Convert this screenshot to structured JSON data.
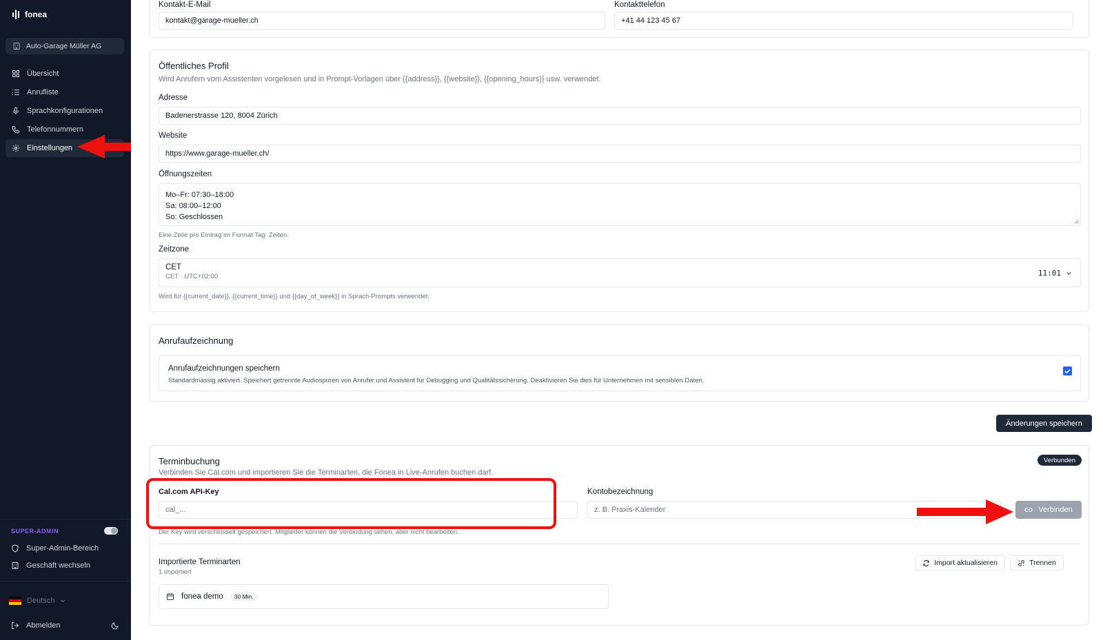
{
  "app": {
    "name": "fonea"
  },
  "sidebar": {
    "company": "Auto-Garage Müller AG",
    "items": [
      {
        "label": "Übersicht",
        "icon": "grid-icon"
      },
      {
        "label": "Anrufliste",
        "icon": "list-icon"
      },
      {
        "label": "Sprachkonfigurationen",
        "icon": "mic-icon"
      },
      {
        "label": "Telefonnummern",
        "icon": "phone-icon"
      },
      {
        "label": "Einstellungen",
        "icon": "gear-icon",
        "active": true
      }
    ],
    "super_admin_label": "SUPER-ADMIN",
    "super_admin_items": [
      {
        "label": "Super-Admin-Bereich",
        "icon": "shield-icon"
      },
      {
        "label": "Geschäft wechseln",
        "icon": "building-icon"
      }
    ],
    "language": "Deutsch",
    "logout": "Abmelden"
  },
  "contact": {
    "email_label": "Kontakt-E-Mail",
    "email_value": "kontakt@garage-mueller.ch",
    "phone_label": "Kontakttelefon",
    "phone_value": "+41 44 123 45 67"
  },
  "profile": {
    "title": "Öffentliches Profil",
    "description": "Wird Anrufern vom Assistenten vorgelesen und in Prompt-Vorlagen über {{address}}, {{website}}, {{opening_hours}} usw. verwendet.",
    "address_label": "Adresse",
    "address_value": "Badenerstrasse 120, 8004 Zürich",
    "website_label": "Website",
    "website_value": "https://www.garage-mueller.ch/",
    "hours_label": "Öffnungszeiten",
    "hours_lines": [
      "Mo–Fr: 07:30–18:00",
      "Sa: 08:00–12:00",
      "So: Geschlossen"
    ],
    "hours_hint": "Eine Zeile pro Eintrag im Format Tag: Zeiten.",
    "timezone_label": "Zeitzone",
    "timezone_value": "CET",
    "timezone_sub": "CET · UTC+02:00",
    "timezone_time": "11:01",
    "timezone_hint": "Wird für {{current_date}}, {{current_time}} und {{day_of_week}} in Sprach-Prompts verwendet."
  },
  "recording": {
    "title": "Anrufaufzeichnung",
    "option_title": "Anrufaufzeichnungen speichern",
    "option_description": "Standardmässig aktiviert. Speichert getrennte Audiospuren von Anrufer und Assistent für Debugging und Qualitätssicherung. Deaktivieren Sie dies für Unternehmen mit sensiblen Daten.",
    "checked": true
  },
  "save_button": "Änderungen speichern",
  "booking": {
    "title": "Terminbuchung",
    "description": "Verbinden Sie Cal.com und importieren Sie die Terminarten, die Fonea in Live-Anrufen buchen darf.",
    "status_badge": "Verbunden",
    "api_key_label": "Cal.com API-Key",
    "api_key_placeholder": "cal_...",
    "account_label": "Kontobezeichnung",
    "account_placeholder": "z. B. Praxis-Kalender",
    "connect_button": "Verbinden",
    "key_hint": "Der Key wird verschlüsselt gespeichert. Mitglieder können die Verbindung sehen, aber nicht bearbeiten.",
    "imported_title": "Importierte Terminarten",
    "imported_count": "1 importiert",
    "refresh_button": "Import aktualisieren",
    "disconnect_button": "Trennen",
    "event_types": [
      {
        "name": "fonea demo",
        "duration": "30 Min."
      }
    ]
  },
  "colors": {
    "sidebar": "#111827",
    "accent": "#1f2937",
    "annotation": "#ef1010",
    "checkbox": "#2563eb"
  }
}
